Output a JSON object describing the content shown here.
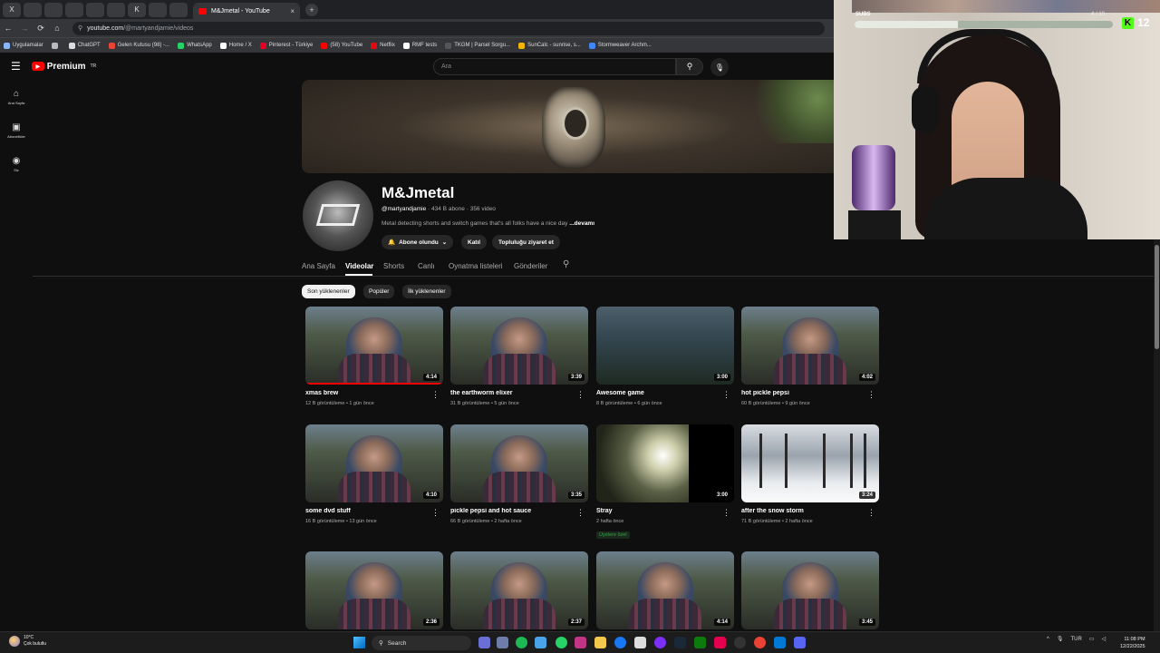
{
  "browser": {
    "pinned_tabs": [
      "X",
      "",
      "",
      "",
      "",
      "",
      "K",
      "",
      ""
    ],
    "active_tab_title": "M&Jmetal - YouTube",
    "close_glyph": "×",
    "new_tab_glyph": "+",
    "url_host": "youtube.com",
    "url_path": "/@martyandjamie/videos",
    "bookmarks": [
      {
        "label": "Uygulamalar",
        "color": "#8ab4f8"
      },
      {
        "label": "",
        "color": "#bbbbbb"
      },
      {
        "label": "ChatGPT",
        "color": "#dddddd"
      },
      {
        "label": "Gelen Kutusu (98) -...",
        "color": "#ea4335"
      },
      {
        "label": "WhatsApp",
        "color": "#25d366"
      },
      {
        "label": "Home / X",
        "color": "#ffffff"
      },
      {
        "label": "Pinterest - Türkiye",
        "color": "#e60023"
      },
      {
        "label": "(58) YouTube",
        "color": "#ff0000"
      },
      {
        "label": "Netflix",
        "color": "#e50914"
      },
      {
        "label": "RMF tests",
        "color": "#ffffff"
      },
      {
        "label": "TKGM | Parsel Sorgu...",
        "color": "#555555"
      },
      {
        "label": "SunCalc - sunrise, s...",
        "color": "#f4b400"
      },
      {
        "label": "Stormweaver Archm...",
        "color": "#4285f4"
      }
    ]
  },
  "masthead": {
    "logo_text": "Premium",
    "region": "TR",
    "search_placeholder": "Ara"
  },
  "guide": [
    {
      "label": "Ana Sayfa",
      "icon": "home-icon"
    },
    {
      "label": "Abonelikler",
      "icon": "subscriptions-icon"
    },
    {
      "label": "Siz",
      "icon": "you-icon"
    }
  ],
  "channel": {
    "name": "M&Jmetal",
    "handle": "@martyandjamie",
    "subscribers": "434 B abone",
    "video_count": "356 video",
    "description": "Metal detecting shorts and switch games that's all folks have a nice day",
    "more_label": "...devamı",
    "subscribed_label": "Abone olundu",
    "join_label": "Katıl",
    "community_label": "Topluluğu ziyaret et",
    "tabs": [
      "Ana Sayfa",
      "Videolar",
      "Shorts",
      "Canlı",
      "Oynatma listeleri",
      "Gönderiler"
    ],
    "active_tab": "Videolar",
    "chips": [
      "Son yüklenenler",
      "Popüler",
      "İlk yüklenenler"
    ]
  },
  "videos": [
    {
      "title": "xmas brew",
      "views": "12 B görüntüleme",
      "age": "1 gün önce",
      "duration": "4:14",
      "watched": 1.0,
      "scene": "shop"
    },
    {
      "title": "the earthworm elixer",
      "views": "31 B görüntüleme",
      "age": "5 gün önce",
      "duration": "3:39",
      "watched": 0,
      "scene": "shop"
    },
    {
      "title": "Awesome game",
      "views": "8 B görüntüleme",
      "age": "6 gün önce",
      "duration": "3:00",
      "watched": 0,
      "scene": "forest"
    },
    {
      "title": "hot pickle pepsi",
      "views": "60 B görüntüleme",
      "age": "9 gün önce",
      "duration": "4:02",
      "watched": 0,
      "scene": "shop"
    },
    {
      "title": "some dvd stuff",
      "views": "16 B görüntüleme",
      "age": "13 gün önce",
      "duration": "4:10",
      "watched": 0,
      "scene": "shop"
    },
    {
      "title": "pickle pepsi and hot sauce",
      "views": "66 B görüntüleme",
      "age": "2 hafta önce",
      "duration": "3:35",
      "watched": 0,
      "scene": "shop"
    },
    {
      "title": "Stray",
      "views": "2 hafta önce",
      "age": "",
      "duration": "3:00",
      "watched": 0,
      "scene": "dark",
      "badge": "Üyelere özel"
    },
    {
      "title": "after the snow storm",
      "views": "71 B görüntüleme",
      "age": "2 hafta önce",
      "duration": "3:24",
      "watched": 0,
      "scene": "snow"
    },
    {
      "title": "",
      "views": "",
      "age": "",
      "duration": "2:36",
      "watched": 0,
      "scene": "shop"
    },
    {
      "title": "",
      "views": "",
      "age": "",
      "duration": "2:37",
      "watched": 0,
      "scene": "shop"
    },
    {
      "title": "",
      "views": "",
      "age": "",
      "duration": "4:14",
      "watched": 0,
      "scene": "shop"
    },
    {
      "title": "",
      "views": "",
      "age": "",
      "duration": "3:45",
      "watched": 0,
      "scene": "shop"
    }
  ],
  "stream_overlay": {
    "subs_label": "SUBS",
    "subs_count": "4 / 10",
    "subs_progress": 0.4,
    "kick_count": "12"
  },
  "taskbar": {
    "temperature": "10°C",
    "weather": "Çok bulutlu",
    "search_label": "Search",
    "language": "TUR",
    "time": "11:08 PM",
    "date": "12/22/2025"
  }
}
